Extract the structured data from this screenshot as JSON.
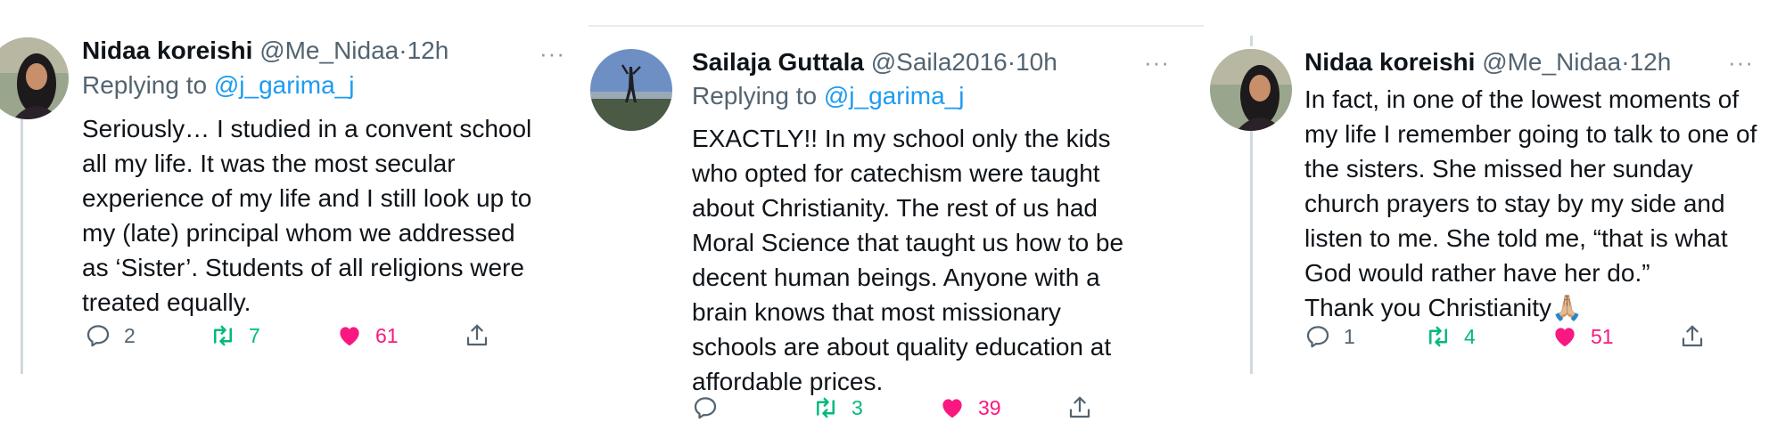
{
  "tweets": [
    {
      "name": "Nidaa koreishi",
      "handle": "@Me_Nidaa",
      "dot": "·",
      "time": "12h",
      "more": "···",
      "replying_prefix": "Replying to",
      "replying_to": "@j_garima_j",
      "lines": [
        "Seriously… I studied in a convent school",
        "all my life. It was the most secular",
        "experience of my life and I still look up to",
        "my (late) principal whom we addressed",
        "as ‘Sister’. Students of all religions were",
        "treated equally."
      ],
      "replies": "2",
      "retweets": "7",
      "likes": "61",
      "icons": {
        "reply": "reply-icon",
        "retweet": "retweet-icon",
        "like": "heart-icon",
        "share": "share-icon"
      }
    },
    {
      "name": "Sailaja Guttala",
      "handle": "@Saila2016",
      "dot": "·",
      "time": "10h",
      "more": "···",
      "replying_prefix": "Replying to",
      "replying_to": "@j_garima_j",
      "lines": [
        "EXACTLY!! In my school only the kids",
        "who opted for catechism were taught",
        "about Christianity. The rest of us had",
        "Moral Science that taught us how to be",
        "decent human beings. Anyone with a",
        "brain knows that most missionary",
        "schools are about quality education at",
        "affordable prices."
      ],
      "replies": "",
      "retweets": "3",
      "likes": "39"
    },
    {
      "name": "Nidaa koreishi",
      "handle": "@Me_Nidaa",
      "dot": "·",
      "time": "12h",
      "more": "···",
      "lines": [
        "In fact, in one of the lowest moments of",
        "my life I remember going to talk to one of",
        "the sisters. She missed her sunday",
        "church prayers to stay by my side and",
        "listen to me. She told me, “that is what",
        "God would rather have her do.”",
        "Thank you Christianity🙏🏼"
      ],
      "replies": "1",
      "retweets": "4",
      "likes": "51"
    }
  ],
  "colors": {
    "mention": "#1d9bf0",
    "retweet": "#00ba7c",
    "like": "#f91880",
    "muted": "#536471",
    "thread_line": "#cfd9de"
  }
}
